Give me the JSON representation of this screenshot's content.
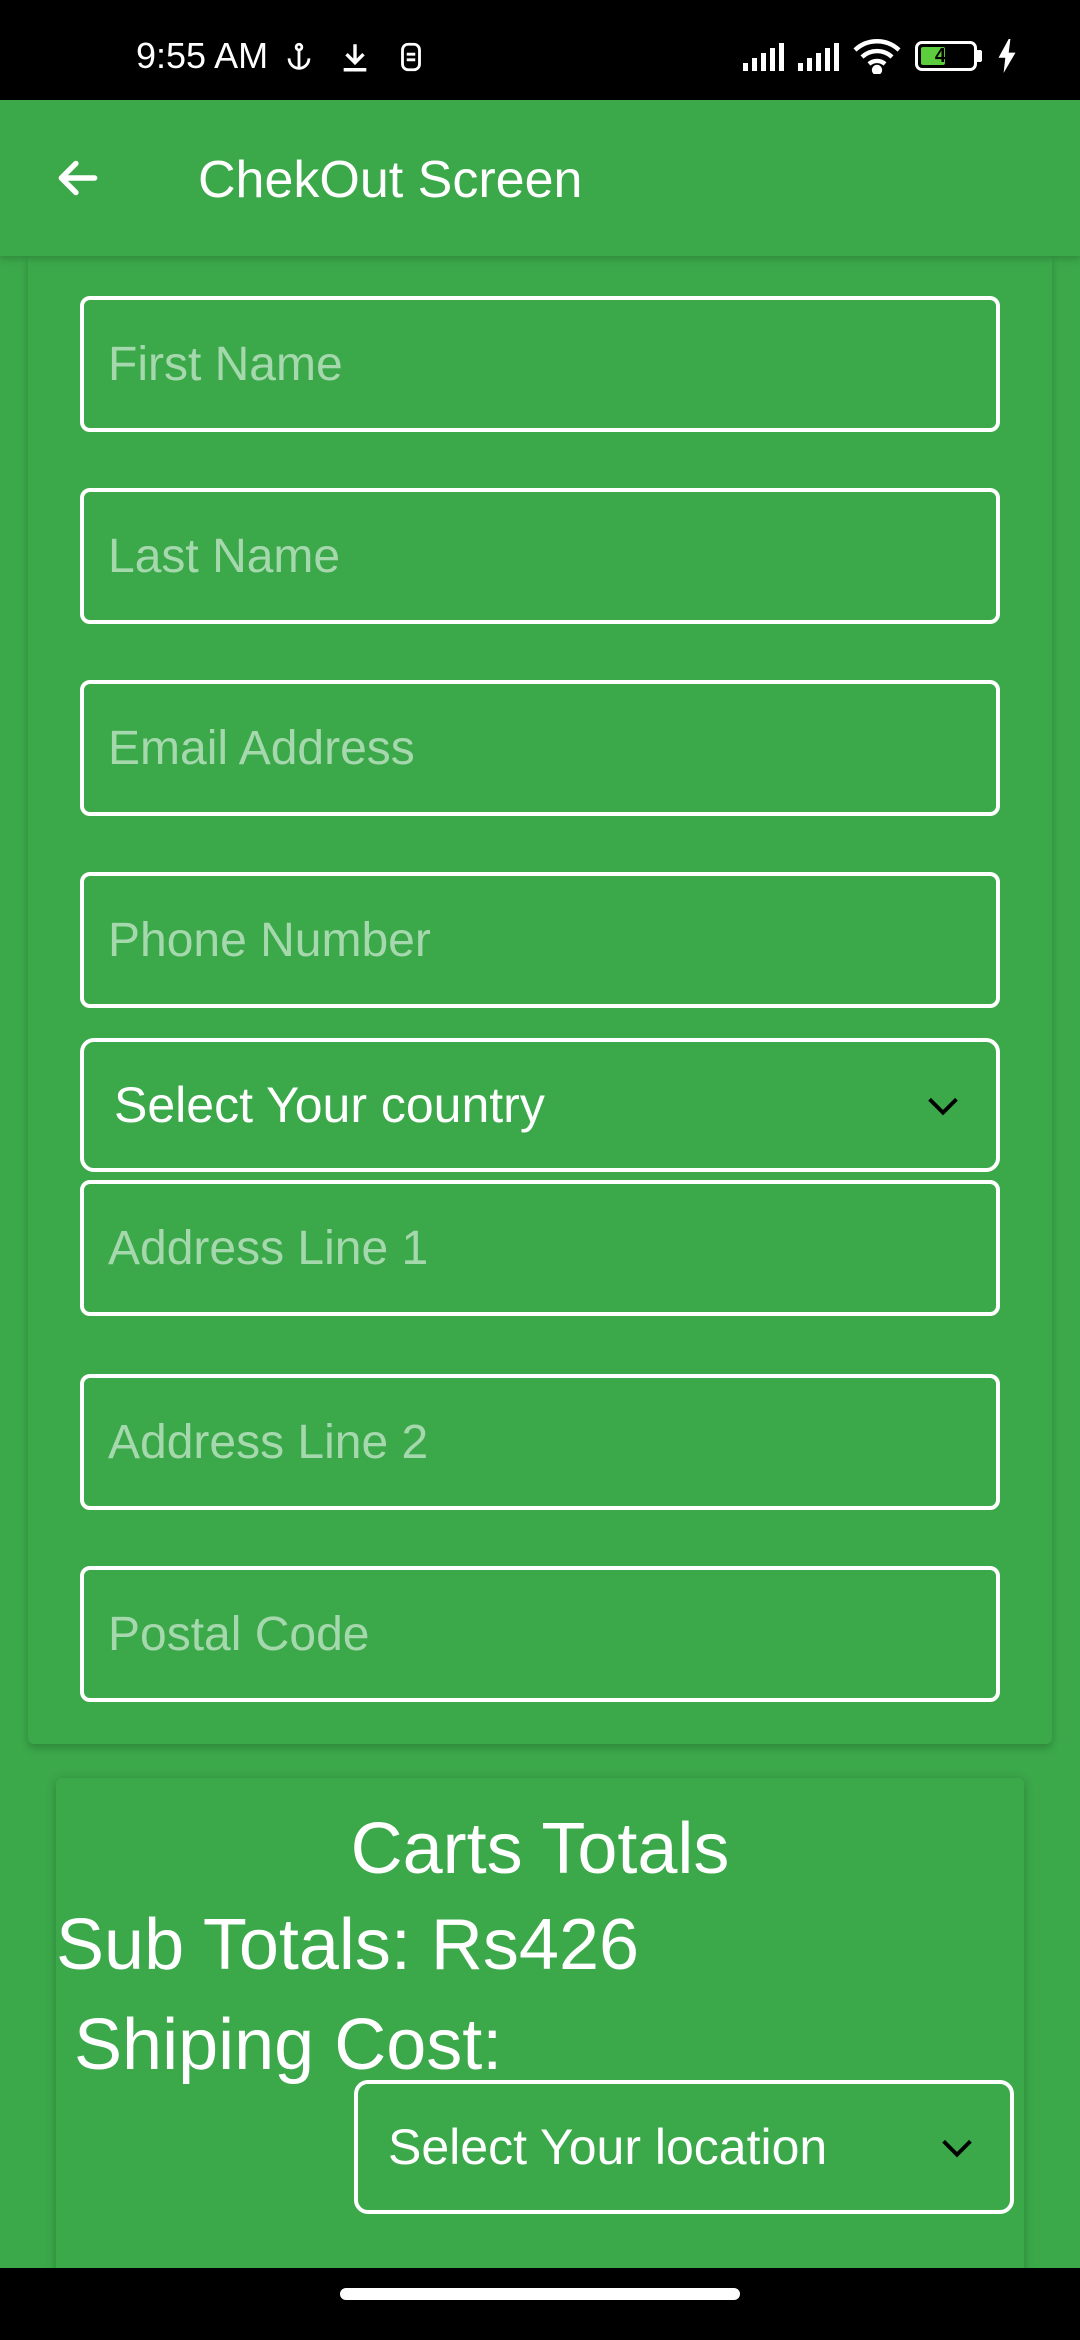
{
  "status_bar": {
    "time": "9:55 AM",
    "battery": "44",
    "icons": [
      "anchor-icon",
      "download-icon",
      "shield-icon",
      "signal-icon",
      "signal-icon",
      "wifi-icon",
      "battery-icon",
      "charging-icon"
    ]
  },
  "app_bar": {
    "title": "ChekOut Screen",
    "back_icon": "arrow-left-icon"
  },
  "form": {
    "first_name": {
      "placeholder": "First Name",
      "value": ""
    },
    "last_name": {
      "placeholder": "Last Name",
      "value": ""
    },
    "email": {
      "placeholder": "Email Address",
      "value": ""
    },
    "phone": {
      "placeholder": "Phone Number",
      "value": ""
    },
    "country_select": {
      "selected": "Select Your country"
    },
    "address1": {
      "placeholder": "Address Line 1",
      "value": ""
    },
    "address2": {
      "placeholder": "Address Line 2",
      "value": ""
    },
    "postal_code": {
      "placeholder": "Postal Code",
      "value": ""
    }
  },
  "totals": {
    "title": "Carts Totals",
    "subtotal": "Sub Totals: Rs426",
    "shipping_label": "Shiping Cost:",
    "location_select": {
      "selected": "Select Your location"
    }
  },
  "colors": {
    "primary": "#3ba84a",
    "text": "#ffffff",
    "placeholder": "rgba(255,255,255,0.55)"
  }
}
